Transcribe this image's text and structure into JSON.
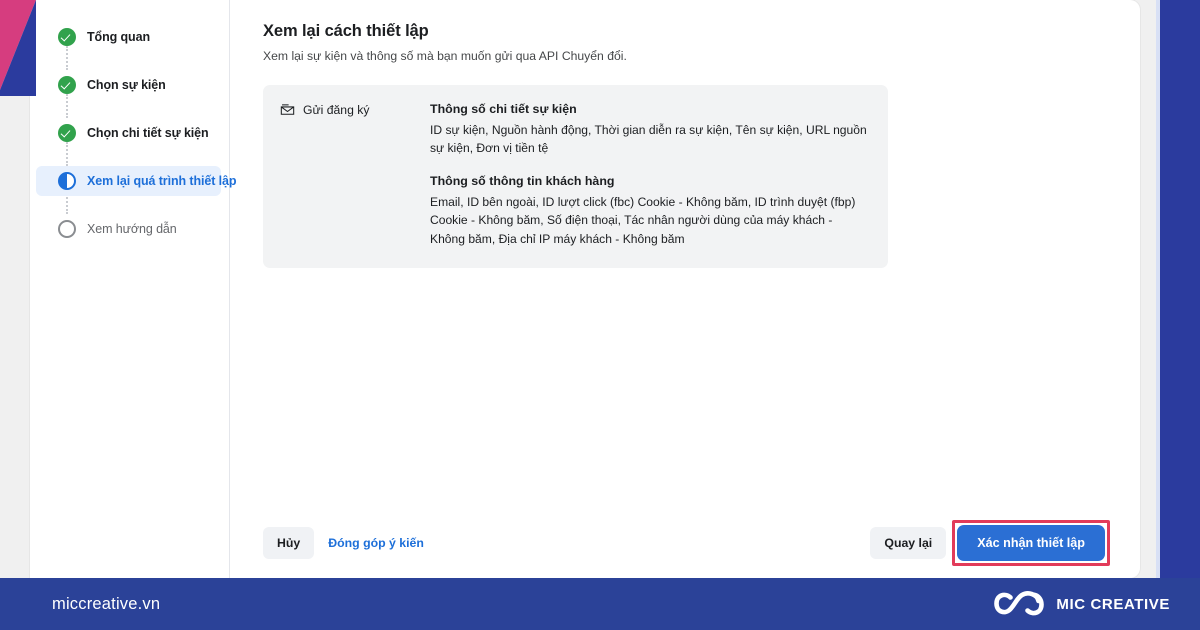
{
  "decor": {
    "pink_hex": "#d63d7f",
    "blue_hex": "#2b3b9e"
  },
  "sidebar": {
    "steps": [
      {
        "label": "Tổng quan",
        "state": "done",
        "icon": "check-circle-icon"
      },
      {
        "label": "Chọn sự kiện",
        "state": "done",
        "icon": "check-circle-icon"
      },
      {
        "label": "Chọn chi tiết sự kiện",
        "state": "done",
        "icon": "check-circle-icon"
      },
      {
        "label": "Xem lại quá trình thiết lập",
        "state": "active",
        "icon": "half-circle-icon"
      },
      {
        "label": "Xem hướng dẫn",
        "state": "pending",
        "icon": "empty-circle-icon"
      }
    ]
  },
  "main": {
    "title": "Xem lại cách thiết lập",
    "subtitle": "Xem lại sự kiện và thông số mà bạn muốn gửi qua API Chuyển đổi.",
    "summary": {
      "event_icon": "envelope-icon",
      "event_label": "Gửi đăng ký",
      "groups": [
        {
          "heading": "Thông số chi tiết sự kiện",
          "values": "ID sự kiện, Nguồn hành động, Thời gian diễn ra sự kiện, Tên sự kiện, URL nguồn sự kiện, Đơn vị tiền tệ"
        },
        {
          "heading": "Thông số thông tin khách hàng",
          "values": "Email, ID bên ngoài, ID lượt click (fbc) Cookie - Không băm, ID trình duyệt (fbp) Cookie - Không băm, Số điện thoại, Tác nhân người dùng của máy khách - Không băm, Địa chỉ IP máy khách - Không băm"
        }
      ]
    }
  },
  "actions": {
    "cancel_label": "Hủy",
    "feedback_label": "Đóng góp ý kiến",
    "back_label": "Quay lại",
    "confirm_label": "Xác nhận thiết lập",
    "confirm_highlight_hex": "#e23b5a",
    "primary_hex": "#2b6fd4"
  },
  "banner": {
    "site": "miccreative.vn",
    "brand": "MIC CREATIVE",
    "logo_icon": "infinity-loops-logo-icon",
    "background_hex": "#2b4298"
  }
}
